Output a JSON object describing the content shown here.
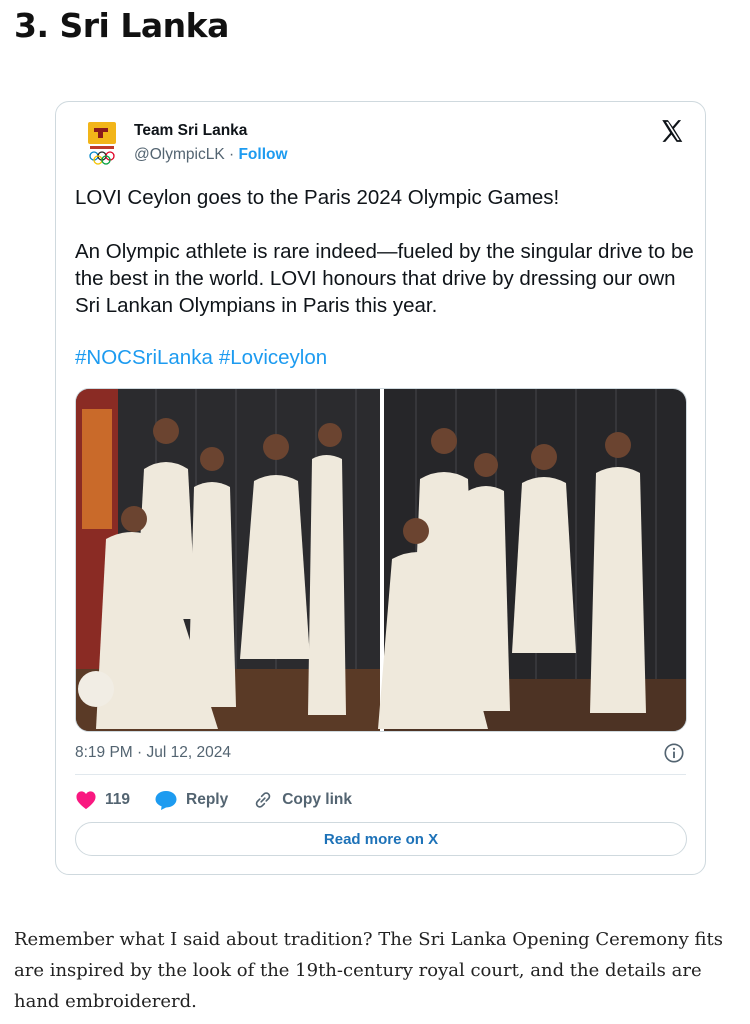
{
  "article": {
    "heading": "3. Sri Lanka",
    "paragraph": "Remember what I said about tradition? The Sri Lanka Opening Ceremony fits are inspired by the look of the 19th-century royal court, and the details are hand embroidererd."
  },
  "tweet": {
    "author_name": "Team Sri Lanka",
    "handle": "@OlympicLK",
    "separator": " · ",
    "follow_label": "Follow",
    "text_line1": "LOVI Ceylon goes to the Paris 2024 Olympic Games!",
    "text_paragraph": "An Olympic athlete is rare indeed—fueled by the singular drive to be the best in the world. LOVI honours that drive by dressing our own Sri Lankan Olympians in Paris this year.",
    "hashtags": [
      "#NOCSriLanka",
      "#Loviceylon"
    ],
    "timestamp": "8:19 PM · Jul 12, 2024",
    "like_count": "119",
    "reply_label": "Reply",
    "copy_link_label": "Copy link",
    "read_more_label": "Read more on X"
  },
  "icons": {
    "x_logo": "x-logo-icon",
    "info": "info-icon",
    "heart": "heart-icon",
    "reply": "speech-bubble-icon",
    "copy_link": "link-icon"
  },
  "colors": {
    "link_blue": "#1d9bf0",
    "like_pink": "#f91880",
    "reply_blue": "#1d9bf0"
  }
}
